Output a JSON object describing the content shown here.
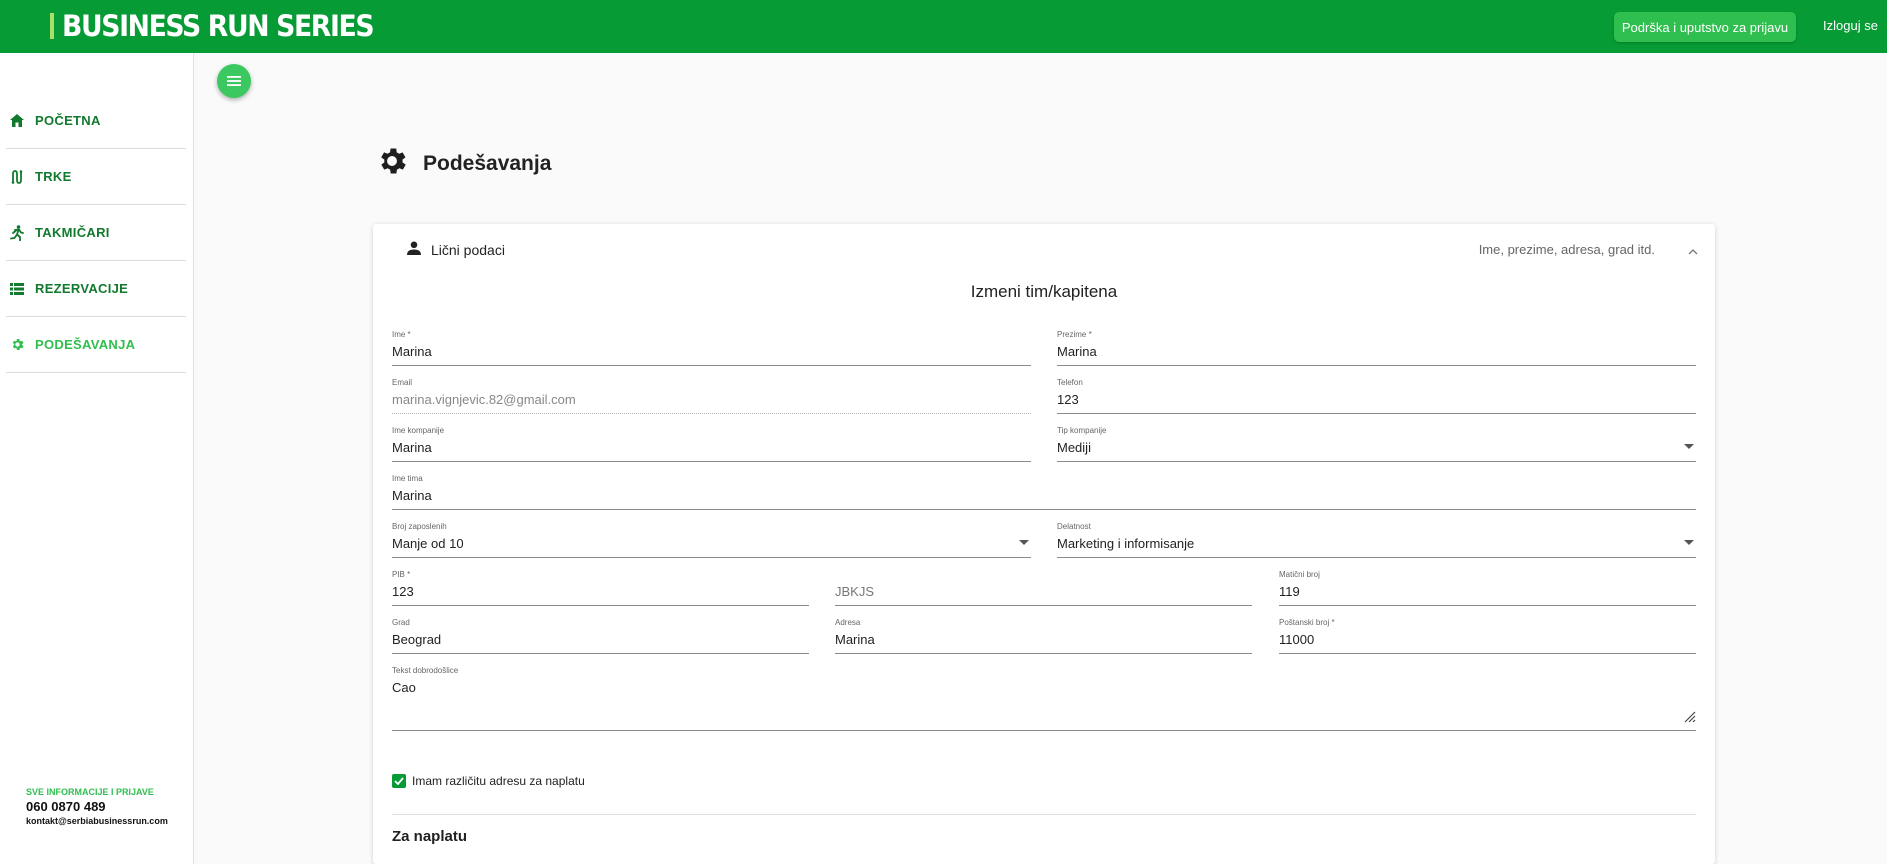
{
  "header": {
    "brand": "BUSINESS RUN SERIES",
    "support_label": "Podrška i uputstvo za prijavu",
    "logout_label": "Izloguj se"
  },
  "sidebar": {
    "items": [
      {
        "label": "POČETNA",
        "icon": "home-icon"
      },
      {
        "label": "TRKE",
        "icon": "route-icon"
      },
      {
        "label": "TAKMIČARI",
        "icon": "runner-icon"
      },
      {
        "label": "REZERVACIJE",
        "icon": "list-icon"
      },
      {
        "label": "PODEŠAVANJA",
        "icon": "gear-icon",
        "active": true
      }
    ],
    "contact": {
      "title": "SVE INFORMACIJE I PRIJAVE",
      "phone": "060 0870 489",
      "email": "kontakt@serbiabusinessrun.com"
    }
  },
  "page": {
    "title": "Podešavanja"
  },
  "panel": {
    "title": "Lični podaci",
    "subtitle": "Ime, prezime, adresa, grad itd.",
    "form_title": "Izmeni tim/kapitena",
    "fields": {
      "ime": {
        "label": "Ime *",
        "value": "Marina"
      },
      "prezime": {
        "label": "Prezime *",
        "value": "Marina"
      },
      "email": {
        "label": "Email",
        "value": "marina.vignjevic.82@gmail.com"
      },
      "telefon": {
        "label": "Telefon",
        "value": "123"
      },
      "ime_kompanije": {
        "label": "Ime kompanije",
        "value": "Marina"
      },
      "tip_kompanije": {
        "label": "Tip kompanije",
        "value": "Mediji"
      },
      "ime_tima": {
        "label": "Ime tima",
        "value": "Marina"
      },
      "broj_zaposlenih": {
        "label": "Broj zaposlenih",
        "value": "Manje od 10"
      },
      "delatnost": {
        "label": "Delatnost",
        "value": "Marketing i informisanje"
      },
      "pib": {
        "label": "PIB *",
        "value": "123"
      },
      "jbkjs": {
        "placeholder": "JBKJS"
      },
      "maticni_broj": {
        "label": "Matični broj",
        "value": "119"
      },
      "grad": {
        "label": "Grad",
        "value": "Beograd"
      },
      "adresa": {
        "label": "Adresa",
        "value": "Marina"
      },
      "postanski_broj": {
        "label": "Poštanski broj *",
        "value": "11000"
      },
      "tekst_dobrodoslice": {
        "label": "Tekst dobrodošlice",
        "value": "Cao"
      }
    },
    "checkbox_label": "Imam različitu adresu za naplatu",
    "checkbox_checked": true,
    "billing_title": "Za naplatu"
  },
  "colors": {
    "brand_green": "#069b34",
    "accent_green": "#2fbf4f"
  }
}
